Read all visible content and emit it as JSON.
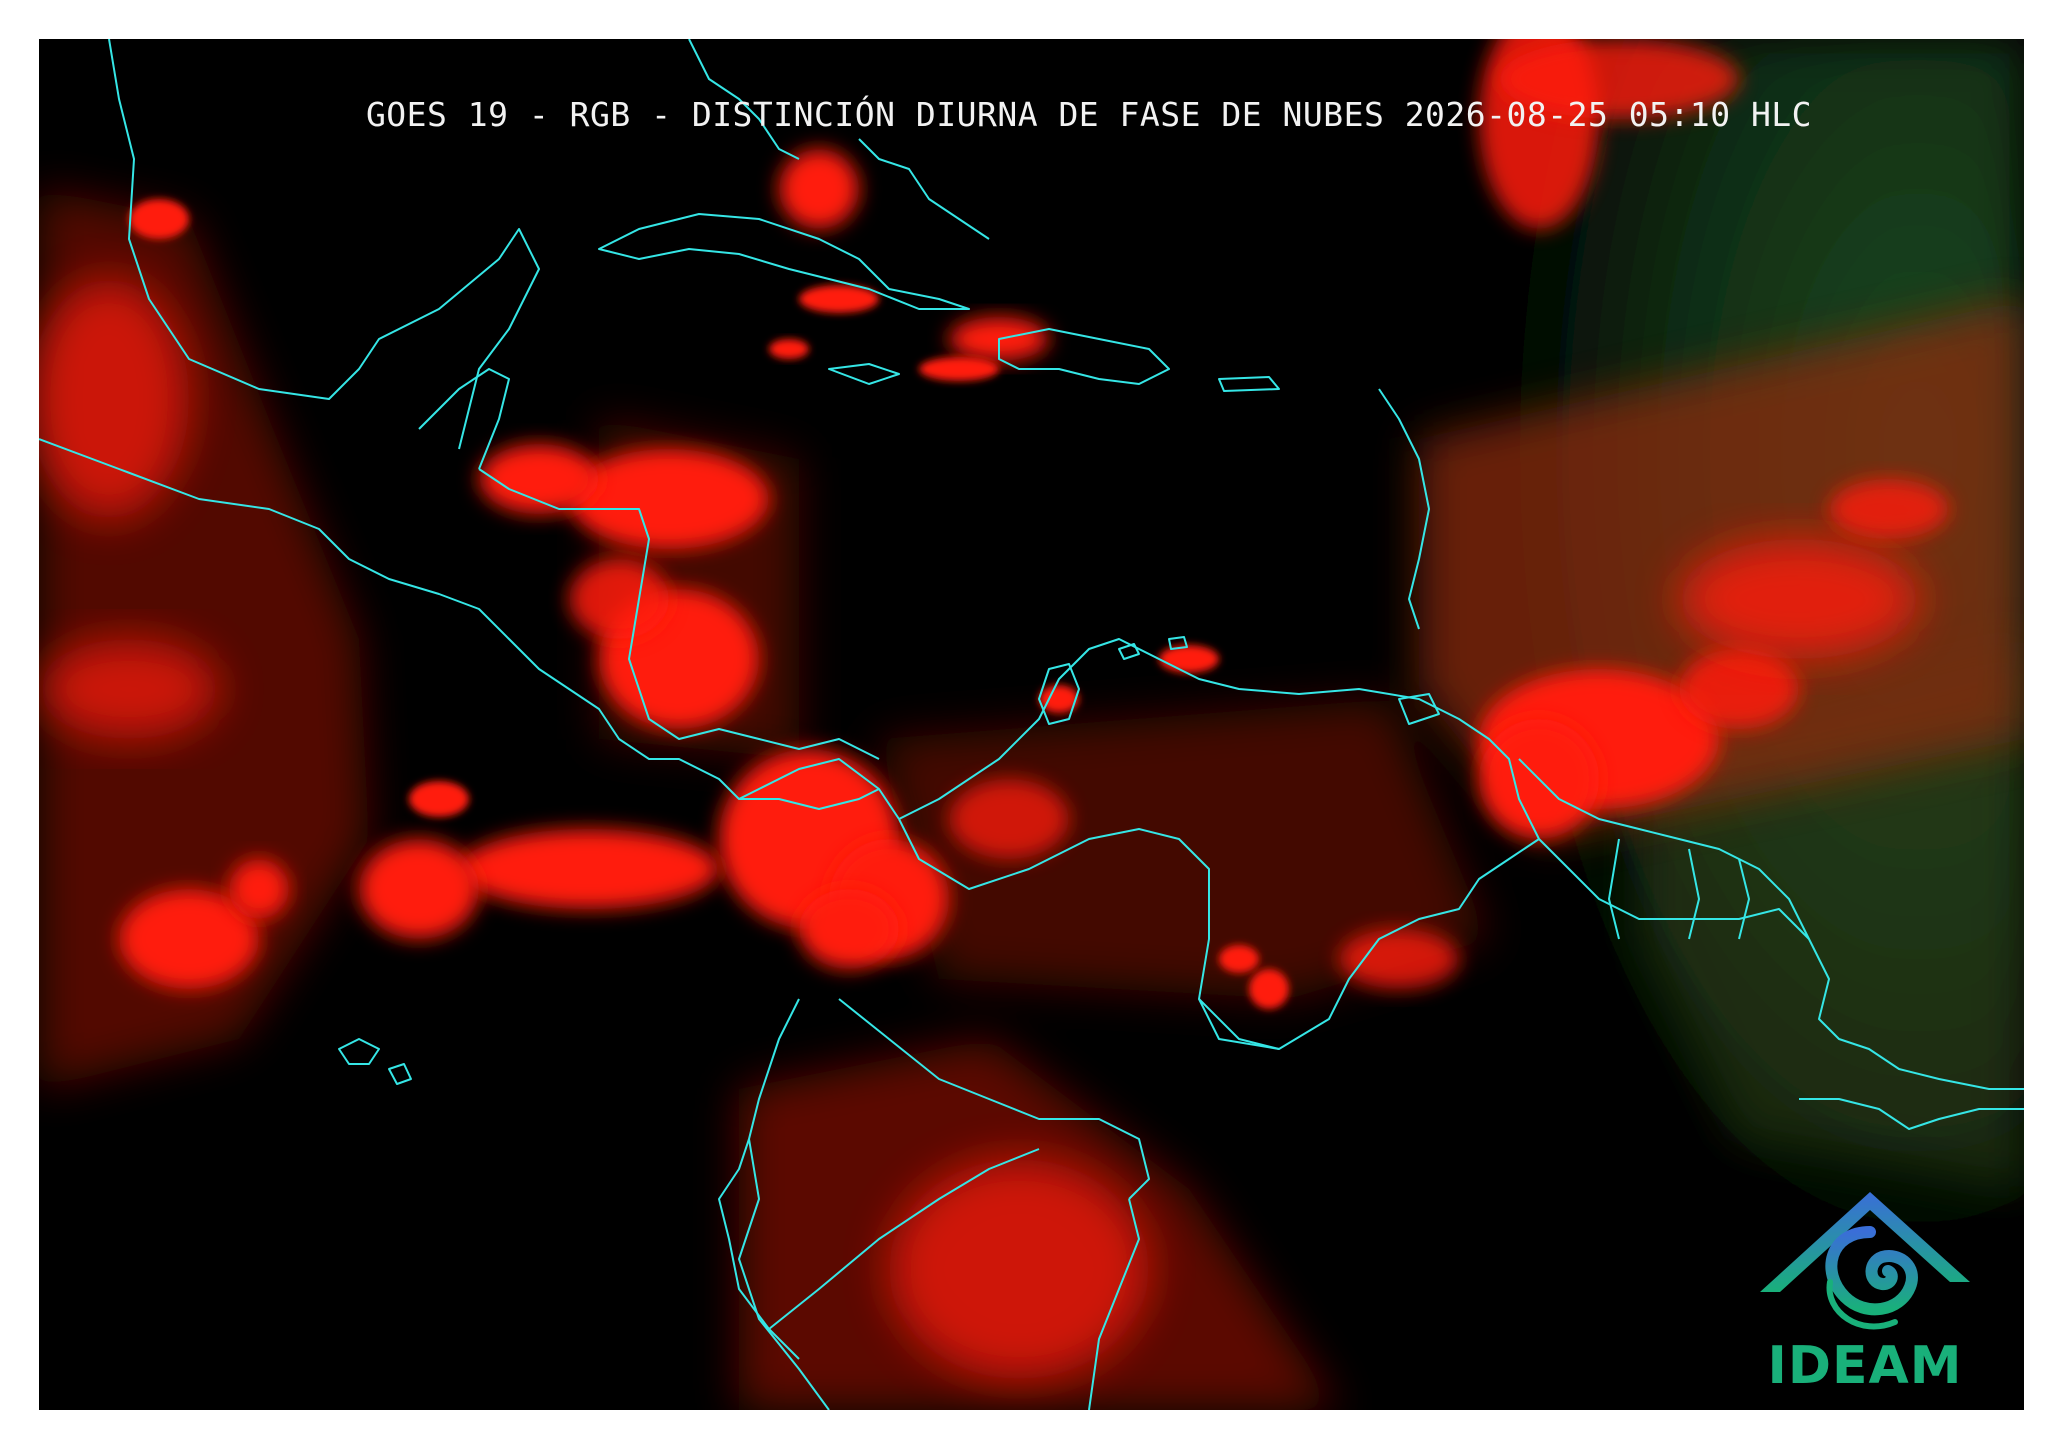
{
  "map": {
    "title": "GOES 19 - RGB - DISTINCIÓN DIURNA DE FASE DE NUBES 2026-08-25 05:10 HLC",
    "product": "RGB - DISTINCIÓN DIURNA DE FASE DE NUBES",
    "satellite": "GOES 19",
    "timestamp": "2026-08-25 05:10 HLC",
    "colors": {
      "background": "#000000",
      "cloud": "#ff1a10",
      "coastline": "#35e6e6",
      "land_green": "#0f3a16",
      "frame": "#ffffff"
    }
  },
  "logo": {
    "text": "IDEAM",
    "icon": "ideam-mountain-spiral-icon"
  }
}
